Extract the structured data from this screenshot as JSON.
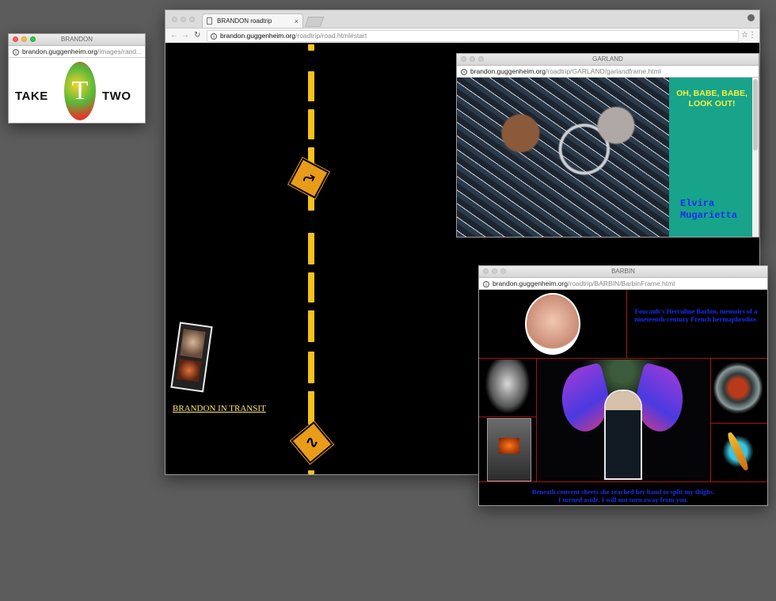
{
  "take_two_window": {
    "title": "BRANDON",
    "url_host": "brandon.guggenheim.org",
    "url_path": "/images/rand...",
    "word_left": "TAKE",
    "glyph": "T",
    "word_right": "TWO"
  },
  "main_window": {
    "tab_title": "BRANDON roadtrip",
    "tab_close": "×",
    "url_host": "brandon.guggenheim.org",
    "url_path": "/roadtrip/road.html#start",
    "nav_back": "←",
    "nav_forward": "→",
    "nav_reload": "↻",
    "bookmark": "☆",
    "menu": "⋮",
    "link_text": "BRANDON IN TRANSIT",
    "sign_top": "⤳",
    "sign_bottom": "∿"
  },
  "garland_window": {
    "title": "GARLAND",
    "url_host": "brandon.guggenheim.org",
    "url_path": "/roadtrip/GARLAND/garlandframe.html",
    "exclaim": "OH, BABE, BABE, LOOK OUT!",
    "name": "Elvira Mugarietta"
  },
  "barbin_window": {
    "title": "BARBIN",
    "url_host": "brandon.guggenheim.org",
    "url_path": "/roadtrip/BARBIN/BarbinFrame.html",
    "caption": "Foucault's Herculine Barbin, memoirs of a nineteenth-century French hermaphrodite.",
    "quote_1": "Beneath convent sheets she reached her hand to split my thighs.",
    "quote_2": "I turned aside. I will not turn away from you."
  },
  "colors": {
    "desktop": "#5c5c5c",
    "road_line": "#f6c21b",
    "link": "#ffe66b",
    "garland_teal": "#17a48b",
    "garland_yellow": "#f7ee3a",
    "barbin_blue": "#1a2ef0",
    "barbin_grid": "#a51515"
  }
}
